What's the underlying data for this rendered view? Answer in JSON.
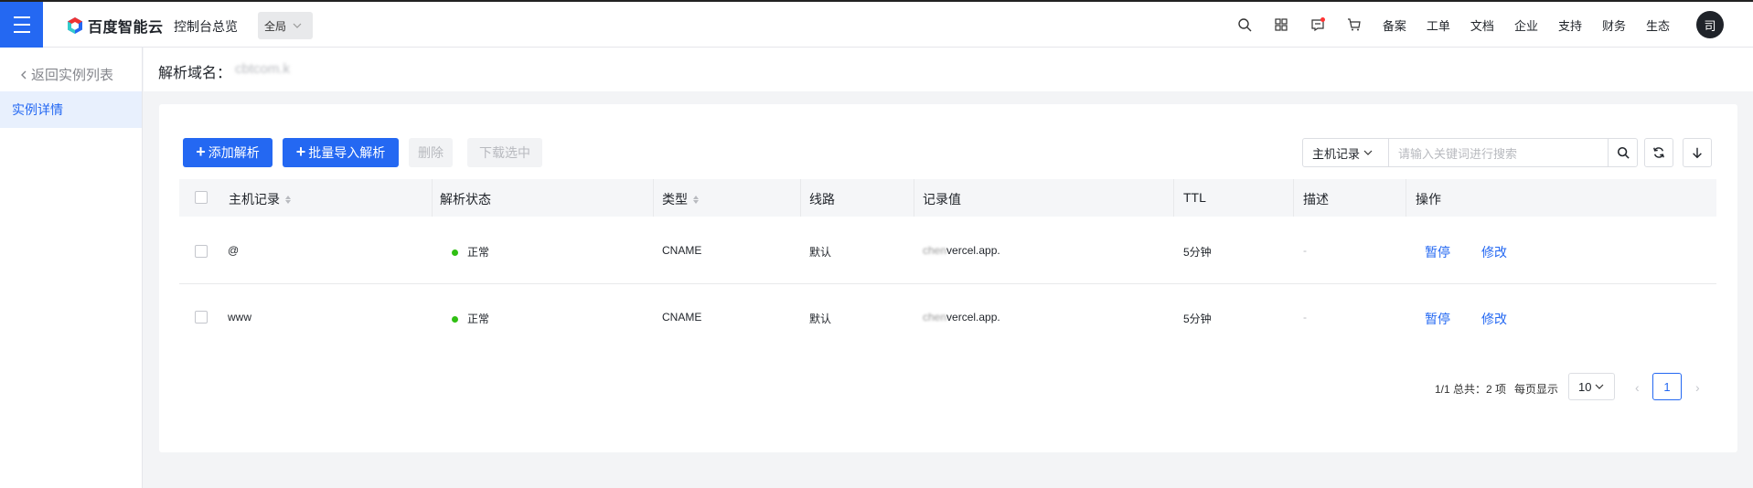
{
  "topbar": {
    "brand": "百度智能云",
    "console": "控制台总览",
    "region": "全局",
    "links": [
      "备案",
      "工单",
      "文档",
      "企业",
      "支持",
      "财务",
      "生态"
    ],
    "avatar": "司"
  },
  "sidebar": {
    "back": "返回实例列表",
    "items": [
      {
        "label": "实例详情"
      }
    ]
  },
  "header": {
    "domain_label": "解析域名：",
    "domain_value": "cbtcom.k"
  },
  "toolbar": {
    "add": "添加解析",
    "bulk_import": "批量导入解析",
    "delete": "删除",
    "download": "下载选中",
    "search_field": "主机记录",
    "search_placeholder": "请输入关键词进行搜索"
  },
  "table": {
    "columns": [
      "主机记录",
      "解析状态",
      "类型",
      "线路",
      "记录值",
      "TTL",
      "描述",
      "操作"
    ],
    "rows": [
      {
        "host": "@",
        "status": "正常",
        "type": "CNAME",
        "line": "默认",
        "value_hidden": "chen",
        "value": "vercel.app.",
        "ttl": "5分钟",
        "desc": "-",
        "pause": "暂停",
        "edit": "修改"
      },
      {
        "host": "www",
        "status": "正常",
        "type": "CNAME",
        "line": "默认",
        "value_hidden": "chen",
        "value": "vercel.app.",
        "ttl": "5分钟",
        "desc": "-",
        "pause": "暂停",
        "edit": "修改"
      }
    ]
  },
  "pagination": {
    "summary": "1/1 总共：2 项",
    "per_page_label": "每页显示",
    "page_size": "10",
    "current_page": "1"
  },
  "colors": {
    "accent": "#2468f2",
    "status_ok": "#30bf13"
  }
}
